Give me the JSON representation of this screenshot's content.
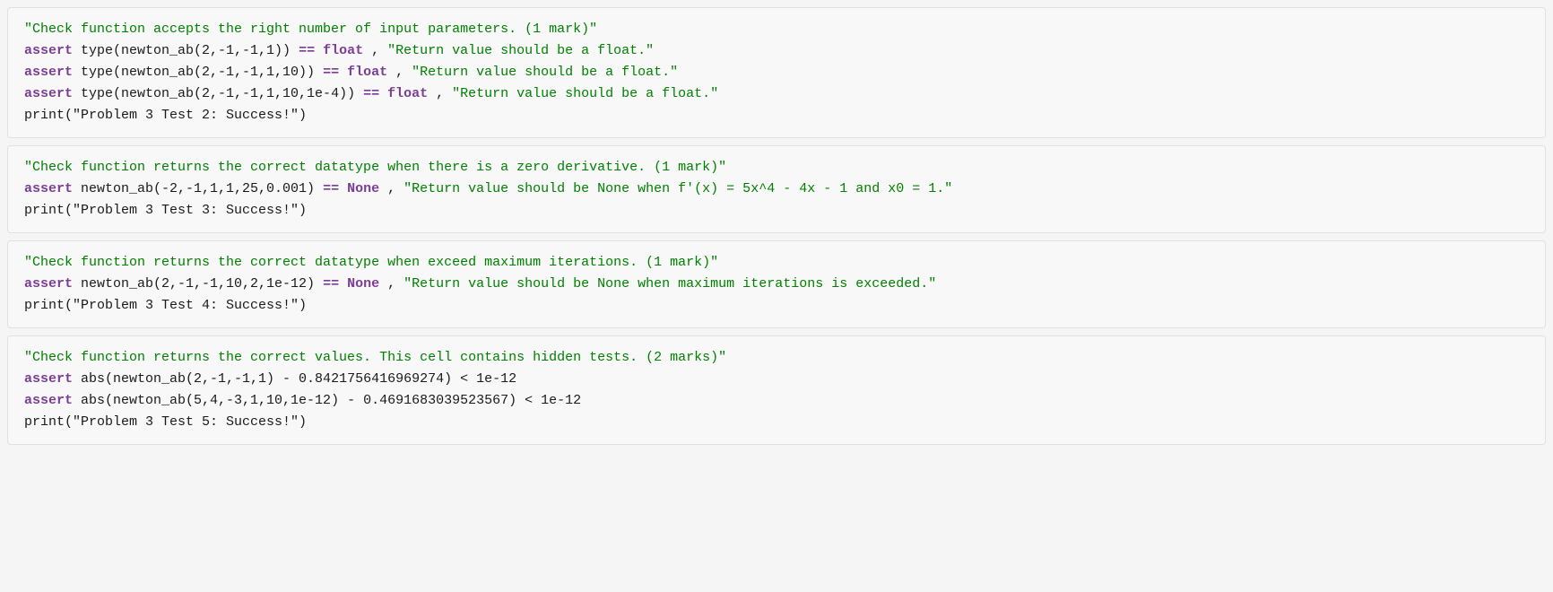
{
  "cells": [
    {
      "id": "cell1",
      "lines": [
        {
          "type": "comment",
          "text": "\"Check function accepts the right number of input parameters. (1 mark)\""
        },
        {
          "type": "code",
          "parts": [
            {
              "t": "assert",
              "cls": "kw-assert"
            },
            {
              "t": " type(newton_ab(2,-1,-1,1)) ",
              "cls": "text-normal"
            },
            {
              "t": "==",
              "cls": "kw-eq"
            },
            {
              "t": " ",
              "cls": "text-normal"
            },
            {
              "t": "float",
              "cls": "kw-float"
            },
            {
              "t": " , ",
              "cls": "text-normal"
            },
            {
              "t": "\"Return value should be a float.\"",
              "cls": "kw-string"
            }
          ]
        },
        {
          "type": "code",
          "parts": [
            {
              "t": "assert",
              "cls": "kw-assert"
            },
            {
              "t": " type(newton_ab(2,-1,-1,1,10)) ",
              "cls": "text-normal"
            },
            {
              "t": "==",
              "cls": "kw-eq"
            },
            {
              "t": " ",
              "cls": "text-normal"
            },
            {
              "t": "float",
              "cls": "kw-float"
            },
            {
              "t": " , ",
              "cls": "text-normal"
            },
            {
              "t": "\"Return value should be a float.\"",
              "cls": "kw-string"
            }
          ]
        },
        {
          "type": "code",
          "parts": [
            {
              "t": "assert",
              "cls": "kw-assert"
            },
            {
              "t": " type(newton_ab(2,-1,-1,1,10,1e-4)) ",
              "cls": "text-normal"
            },
            {
              "t": "==",
              "cls": "kw-eq"
            },
            {
              "t": " ",
              "cls": "text-normal"
            },
            {
              "t": "float",
              "cls": "kw-float"
            },
            {
              "t": " , ",
              "cls": "text-normal"
            },
            {
              "t": "\"Return value should be a float.\"",
              "cls": "kw-string"
            }
          ]
        },
        {
          "type": "code",
          "parts": [
            {
              "t": "print(\"Problem 3 Test 2: Success!\")",
              "cls": "text-normal"
            }
          ]
        }
      ]
    },
    {
      "id": "cell2",
      "lines": [
        {
          "type": "comment",
          "text": "\"Check function returns the correct datatype when there is a zero derivative. (1 mark)\""
        },
        {
          "type": "code",
          "parts": [
            {
              "t": "assert",
              "cls": "kw-assert"
            },
            {
              "t": " newton_ab(-2,-1,1,1,25,0.001) ",
              "cls": "text-normal"
            },
            {
              "t": "==",
              "cls": "kw-eq"
            },
            {
              "t": " ",
              "cls": "text-normal"
            },
            {
              "t": "None",
              "cls": "kw-none"
            },
            {
              "t": " , ",
              "cls": "text-normal"
            },
            {
              "t": "\"Return value should be None when f'(x) = 5x^4 - 4x - 1 and x0 = 1.\"",
              "cls": "kw-string"
            }
          ]
        },
        {
          "type": "code",
          "parts": [
            {
              "t": "print(\"Problem 3 Test 3: Success!\")",
              "cls": "text-normal"
            }
          ]
        }
      ]
    },
    {
      "id": "cell3",
      "lines": [
        {
          "type": "comment",
          "text": "\"Check function returns the correct datatype when exceed maximum iterations. (1 mark)\""
        },
        {
          "type": "code",
          "parts": [
            {
              "t": "assert",
              "cls": "kw-assert"
            },
            {
              "t": " newton_ab(2,-1,-1,10,2,1e-12) ",
              "cls": "text-normal"
            },
            {
              "t": "==",
              "cls": "kw-eq"
            },
            {
              "t": " ",
              "cls": "text-normal"
            },
            {
              "t": "None",
              "cls": "kw-none"
            },
            {
              "t": " , ",
              "cls": "text-normal"
            },
            {
              "t": "\"Return value should be None when maximum iterations is exceeded.\"",
              "cls": "kw-string"
            }
          ]
        },
        {
          "type": "code",
          "parts": [
            {
              "t": "print(\"Problem 3 Test 4: Success!\")",
              "cls": "text-normal"
            }
          ]
        }
      ]
    },
    {
      "id": "cell4",
      "lines": [
        {
          "type": "comment",
          "text": "\"Check function returns the correct values. This cell contains hidden tests. (2 marks)\""
        },
        {
          "type": "code",
          "parts": [
            {
              "t": "assert",
              "cls": "kw-assert"
            },
            {
              "t": " abs(newton_ab(2,-1,-1,1) - 0.8421756416969274) < 1e-12",
              "cls": "text-normal"
            }
          ]
        },
        {
          "type": "code",
          "parts": [
            {
              "t": "assert",
              "cls": "kw-assert"
            },
            {
              "t": " abs(newton_ab(5,4,-3,1,10,1e-12) - 0.4691683039523567) < 1e-12",
              "cls": "text-normal"
            }
          ]
        },
        {
          "type": "code",
          "parts": [
            {
              "t": "print(\"Problem 3 Test 5: Success!\")",
              "cls": "text-normal"
            }
          ]
        }
      ]
    }
  ]
}
